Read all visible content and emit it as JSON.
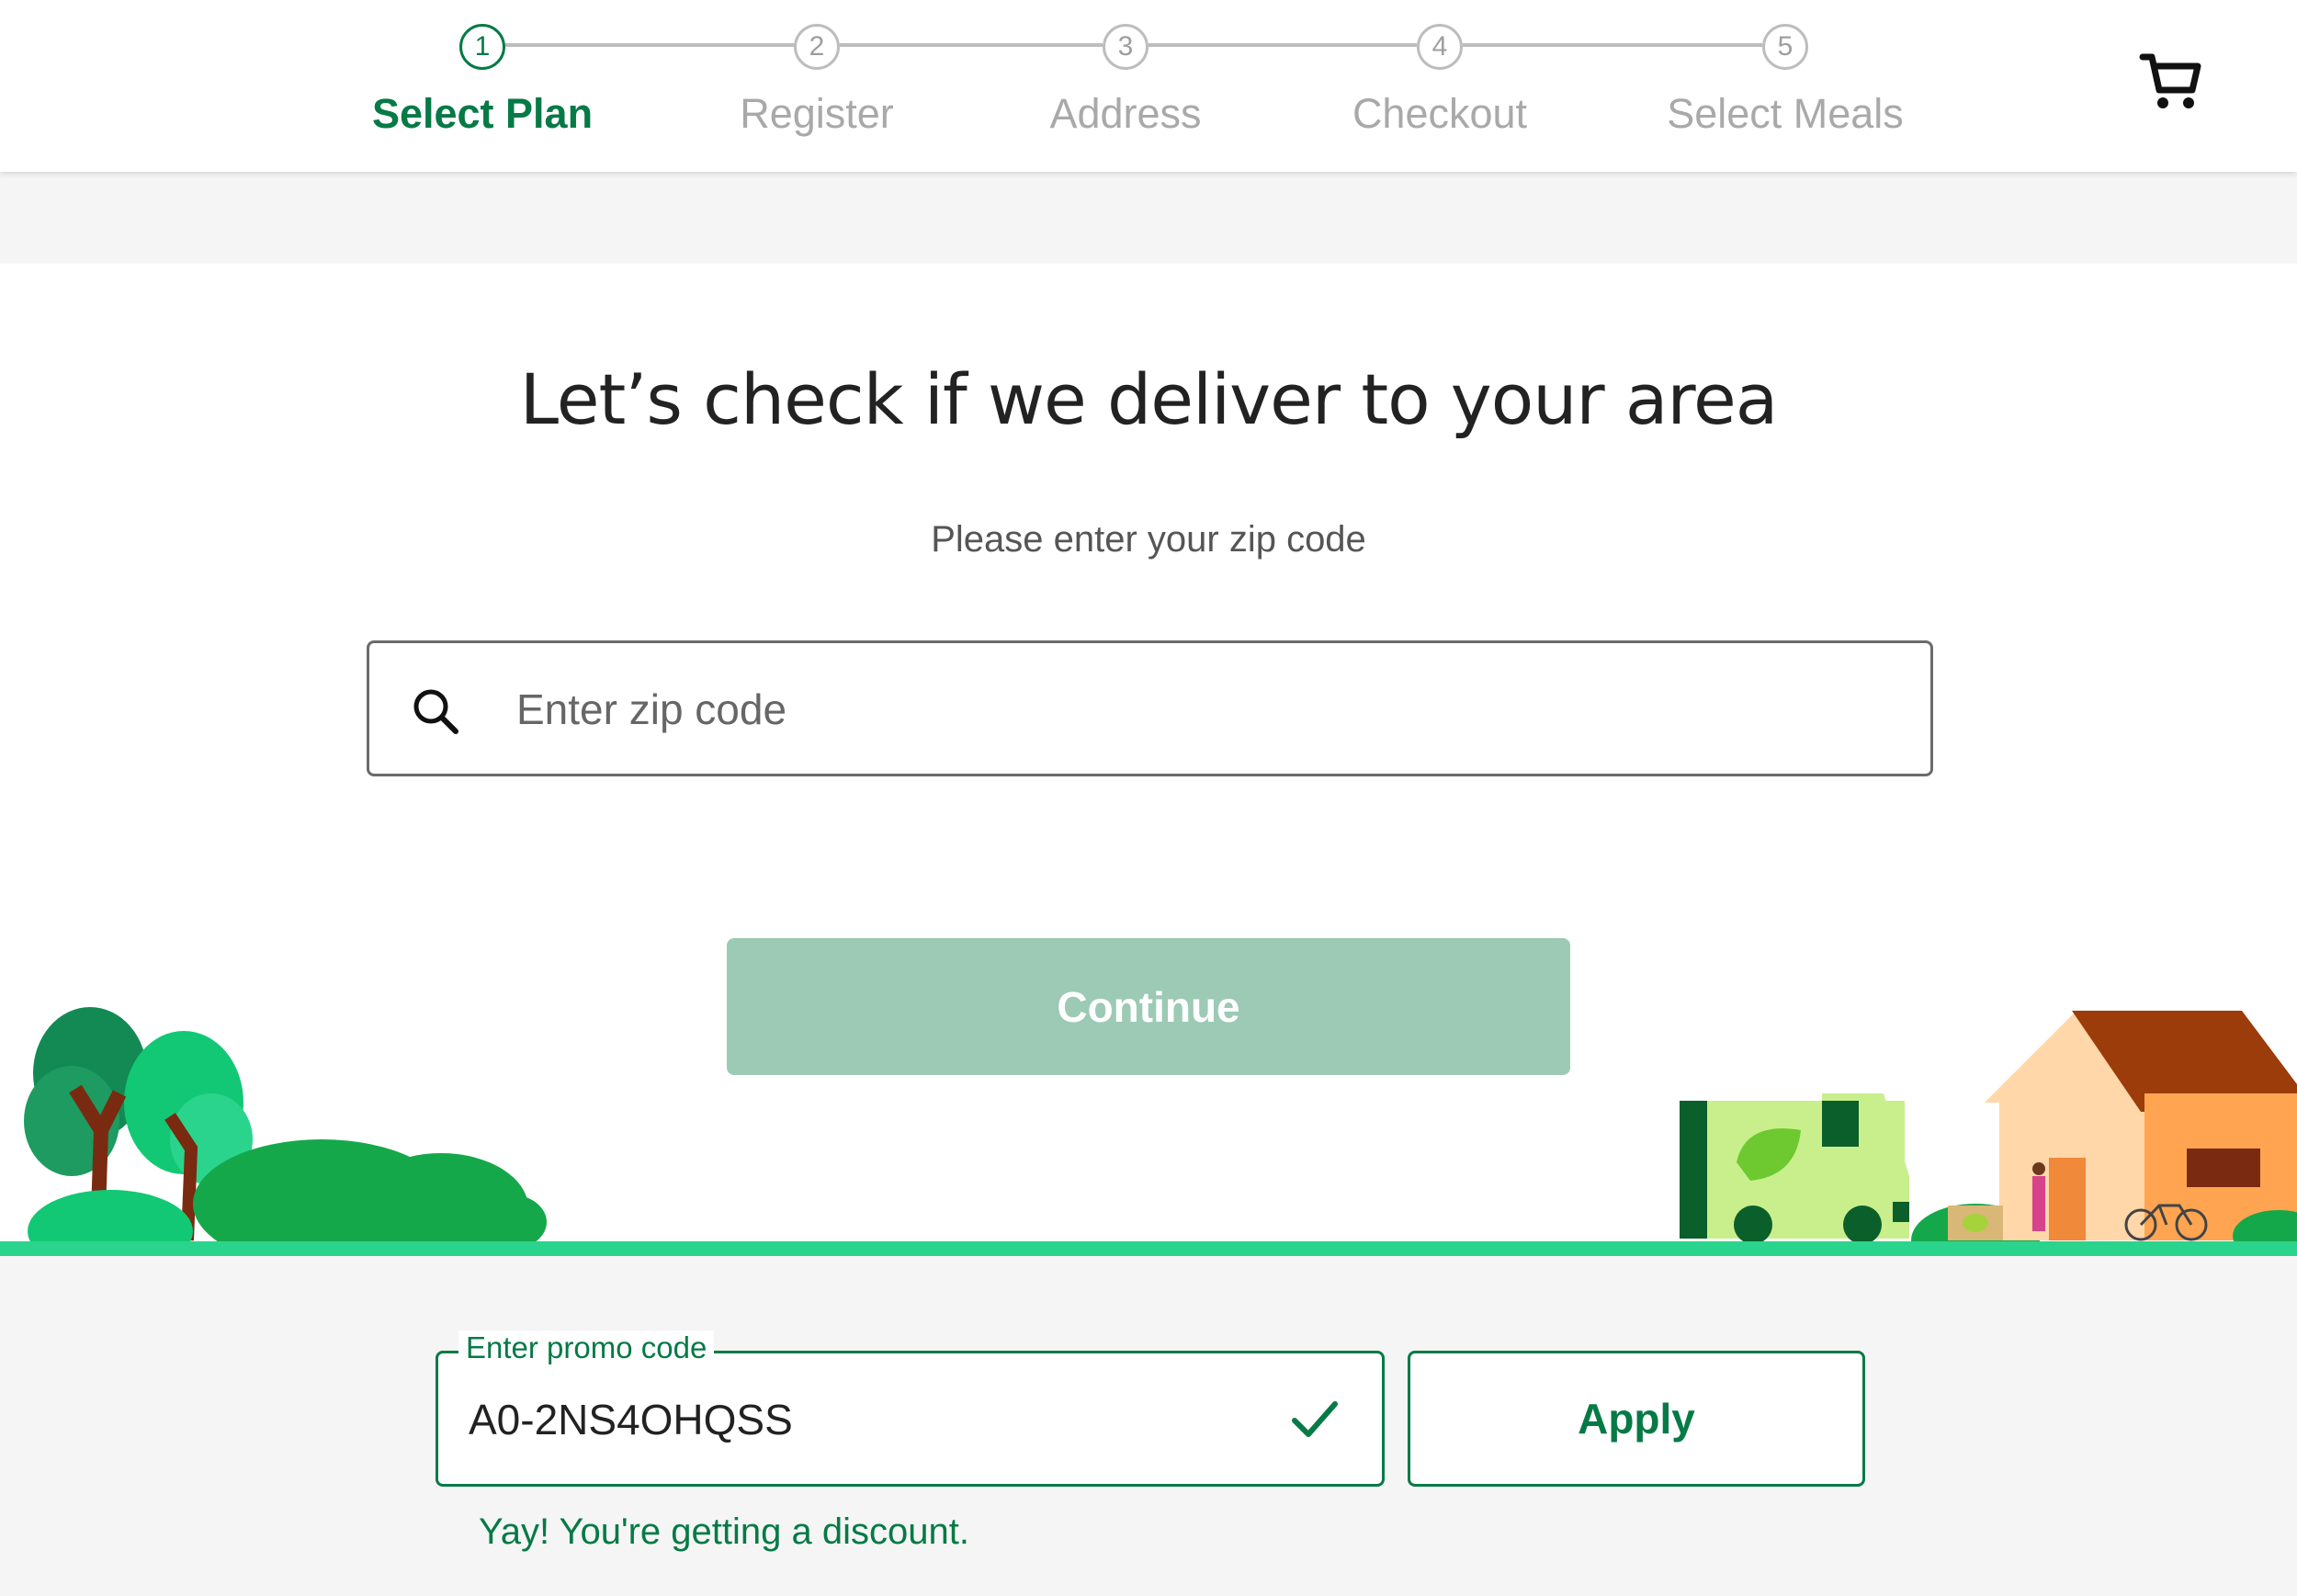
{
  "stepper": {
    "steps": [
      {
        "number": "1",
        "label": "Select Plan",
        "active": true
      },
      {
        "number": "2",
        "label": "Register",
        "active": false
      },
      {
        "number": "3",
        "label": "Address",
        "active": false
      },
      {
        "number": "4",
        "label": "Checkout",
        "active": false
      },
      {
        "number": "5",
        "label": "Select Meals",
        "active": false
      }
    ],
    "active_color": "#067a46",
    "inactive_color": "#a9a9a9"
  },
  "header": {
    "cart_icon": "cart-icon"
  },
  "main": {
    "title": "Let’s check if we deliver to your area",
    "subtitle": "Please enter your zip code",
    "zip_placeholder": "Enter zip code",
    "zip_value": "",
    "search_icon": "search-icon",
    "continue_label": "Continue",
    "continue_color": "#9ccab4"
  },
  "promo": {
    "legend": "Enter promo code",
    "value": "A0-2NS4OHQSS",
    "apply_label": "Apply",
    "message": "Yay! You're getting a discount.",
    "check_icon": "check-icon"
  },
  "colors": {
    "brand_green": "#067a46",
    "ground_green": "#2bd48c"
  }
}
